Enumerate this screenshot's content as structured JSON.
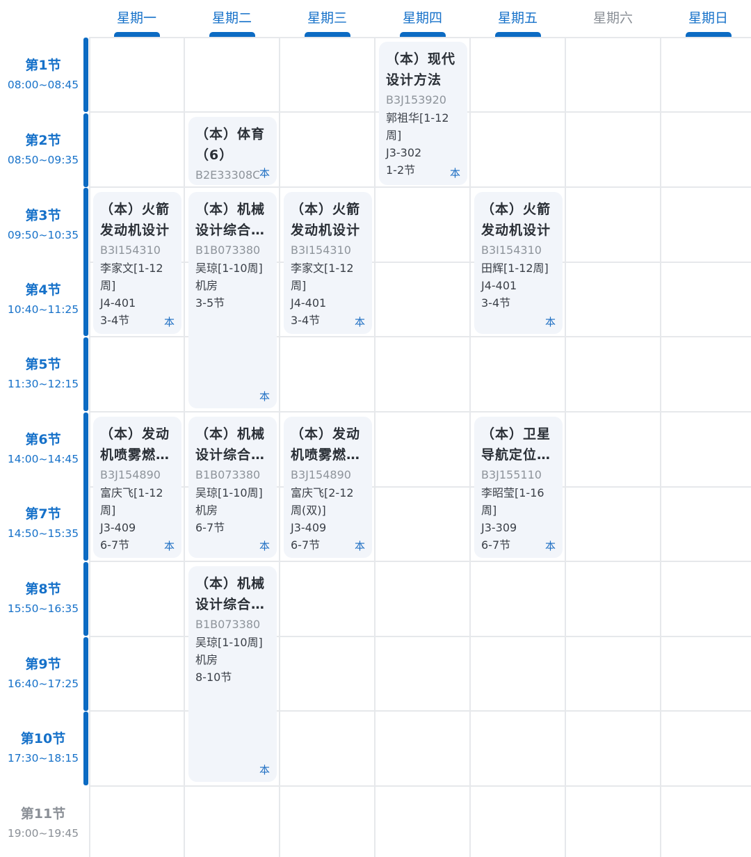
{
  "days": [
    {
      "label": "星期一",
      "active": true
    },
    {
      "label": "星期二",
      "active": true
    },
    {
      "label": "星期三",
      "active": true
    },
    {
      "label": "星期四",
      "active": true
    },
    {
      "label": "星期五",
      "active": true
    },
    {
      "label": "星期六",
      "active": false
    },
    {
      "label": "星期日",
      "active": true
    }
  ],
  "periods": [
    {
      "name": "第1节",
      "time": "08:00~08:45"
    },
    {
      "name": "第2节",
      "time": "08:50~09:35"
    },
    {
      "name": "第3节",
      "time": "09:50~10:35"
    },
    {
      "name": "第4节",
      "time": "10:40~11:25"
    },
    {
      "name": "第5节",
      "time": "11:30~12:15"
    },
    {
      "name": "第6节",
      "time": "14:00~14:45"
    },
    {
      "name": "第7节",
      "time": "14:50~15:35"
    },
    {
      "name": "第8节",
      "time": "15:50~16:35"
    },
    {
      "name": "第9节",
      "time": "16:40~17:25"
    },
    {
      "name": "第10节",
      "time": "17:30~18:15"
    },
    {
      "name": "第11节",
      "time": "19:00~19:45"
    }
  ],
  "courses": [
    {
      "title_lines": [
        "（本）现代",
        "设计方法"
      ],
      "code": "B3J153920",
      "details": [
        "郭祖华[1-12",
        "周]",
        "J3-302",
        "1-2节"
      ],
      "badge": "本"
    },
    {
      "title_lines": [
        "（本）体育",
        "（6）"
      ],
      "code": "B2E33308C",
      "details": [],
      "badge": "本"
    },
    {
      "title_lines": [
        "（本）火箭",
        "发动机设计"
      ],
      "code": "B3I154310",
      "details": [
        "李家文[1-12",
        "周]",
        "J4-401",
        "3-4节"
      ],
      "badge": "本"
    },
    {
      "title_lines": [
        "（本）机械",
        "设计综合…"
      ],
      "code": "B1B073380",
      "details": [
        "吴琼[1-10周]",
        "机房",
        "3-5节"
      ],
      "badge": "本"
    },
    {
      "title_lines": [
        "（本）火箭",
        "发动机设计"
      ],
      "code": "B3I154310",
      "details": [
        "李家文[1-12",
        "周]",
        "J4-401",
        "3-4节"
      ],
      "badge": "本"
    },
    {
      "title_lines": [
        "（本）火箭",
        "发动机设计"
      ],
      "code": "B3I154310",
      "details": [
        "田辉[1-12周]",
        "J4-401",
        "3-4节"
      ],
      "badge": "本"
    },
    {
      "title_lines": [
        "（本）发动",
        "机喷雾燃…"
      ],
      "code": "B3J154890",
      "details": [
        "富庆飞[1-12",
        "周]",
        "J3-409",
        "6-7节"
      ],
      "badge": "本"
    },
    {
      "title_lines": [
        "（本）机械",
        "设计综合…"
      ],
      "code": "B1B073380",
      "details": [
        "吴琼[1-10周]",
        "机房",
        "6-7节"
      ],
      "badge": "本"
    },
    {
      "title_lines": [
        "（本）发动",
        "机喷雾燃…"
      ],
      "code": "B3J154890",
      "details": [
        "富庆飞[2-12",
        "周(双)]",
        "J3-409",
        "6-7节"
      ],
      "badge": "本"
    },
    {
      "title_lines": [
        "（本）卫星",
        "导航定位…"
      ],
      "code": "B3J155110",
      "details": [
        "李昭莹[1-16",
        "周]",
        "J3-309",
        "6-7节"
      ],
      "badge": "本"
    },
    {
      "title_lines": [
        "（本）机械",
        "设计综合…"
      ],
      "code": "B1B073380",
      "details": [
        "吴琼[1-10周]",
        "机房",
        "8-10节"
      ],
      "badge": "本"
    }
  ]
}
